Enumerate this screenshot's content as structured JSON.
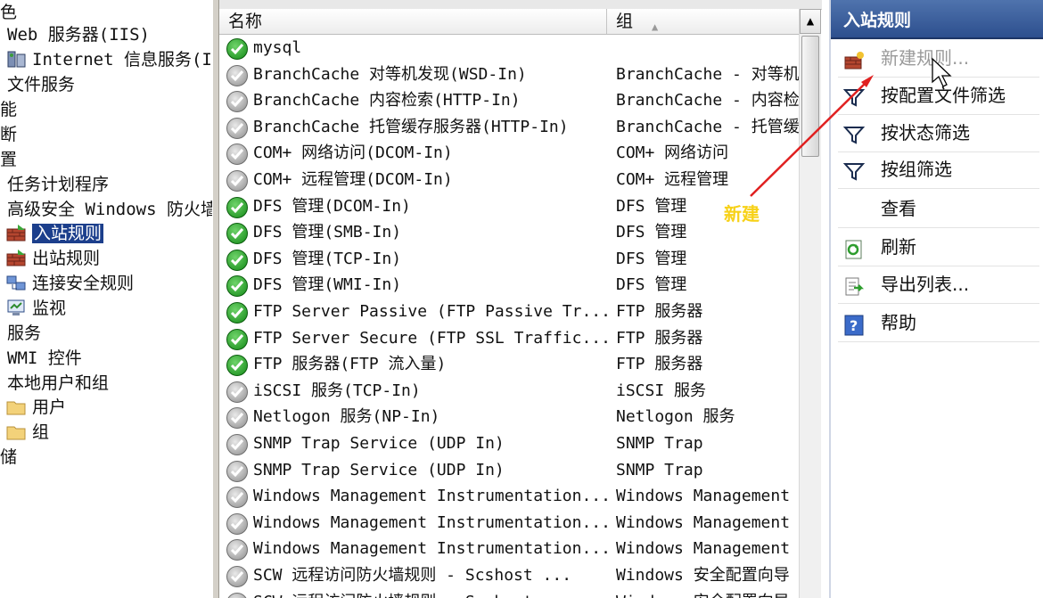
{
  "tree": {
    "items": [
      {
        "label": "色",
        "icon": "none",
        "indent": 0
      },
      {
        "label": "Web 服务器(IIS)",
        "icon": "none",
        "indent": 8
      },
      {
        "label": "Internet 信息服务(I",
        "icon": "iis-icon",
        "indent": 8
      },
      {
        "label": "文件服务",
        "icon": "none",
        "indent": 8
      },
      {
        "label": "能",
        "icon": "none",
        "indent": 0
      },
      {
        "label": "断",
        "icon": "none",
        "indent": 0
      },
      {
        "label": "置",
        "icon": "none",
        "indent": 0
      },
      {
        "label": "任务计划程序",
        "icon": "none",
        "indent": 8
      },
      {
        "label": "高级安全 Windows 防火墙",
        "icon": "none",
        "indent": 8
      },
      {
        "label": "入站规则",
        "icon": "inbound-rules-icon",
        "indent": 8,
        "selected": true
      },
      {
        "label": "出站规则",
        "icon": "outbound-rules-icon",
        "indent": 8
      },
      {
        "label": "连接安全规则",
        "icon": "connection-security-icon",
        "indent": 8
      },
      {
        "label": "监视",
        "icon": "monitor-icon",
        "indent": 8
      },
      {
        "label": "服务",
        "icon": "none",
        "indent": 8
      },
      {
        "label": "WMI 控件",
        "icon": "none",
        "indent": 8
      },
      {
        "label": "本地用户和组",
        "icon": "none",
        "indent": 8
      },
      {
        "label": "用户",
        "icon": "folder-icon",
        "indent": 8
      },
      {
        "label": "组",
        "icon": "folder-icon",
        "indent": 8
      },
      {
        "label": "储",
        "icon": "none",
        "indent": 0
      }
    ]
  },
  "list": {
    "columns": {
      "name": "名称",
      "group": "组"
    },
    "rows": [
      {
        "name": "mysql",
        "group": "",
        "enabled": true
      },
      {
        "name": "BranchCache 对等机发现(WSD-In)",
        "group": "BranchCache - 对等机发现",
        "enabled": false
      },
      {
        "name": "BranchCache 内容检索(HTTP-In)",
        "group": "BranchCache - 内容检索",
        "enabled": false
      },
      {
        "name": "BranchCache 托管缓存服务器(HTTP-In)",
        "group": "BranchCache - 托管缓存",
        "enabled": false
      },
      {
        "name": "COM+ 网络访问(DCOM-In)",
        "group": "COM+ 网络访问",
        "enabled": false
      },
      {
        "name": "COM+ 远程管理(DCOM-In)",
        "group": "COM+ 远程管理",
        "enabled": false
      },
      {
        "name": "DFS 管理(DCOM-In)",
        "group": "DFS 管理",
        "enabled": true
      },
      {
        "name": "DFS 管理(SMB-In)",
        "group": "DFS 管理",
        "enabled": true
      },
      {
        "name": "DFS 管理(TCP-In)",
        "group": "DFS 管理",
        "enabled": true
      },
      {
        "name": "DFS 管理(WMI-In)",
        "group": "DFS 管理",
        "enabled": true
      },
      {
        "name": "FTP Server Passive (FTP Passive Tr...",
        "group": "FTP 服务器",
        "enabled": true
      },
      {
        "name": "FTP Server Secure (FTP SSL Traffic...",
        "group": "FTP 服务器",
        "enabled": true
      },
      {
        "name": "FTP 服务器(FTP 流入量)",
        "group": "FTP 服务器",
        "enabled": true
      },
      {
        "name": "iSCSI 服务(TCP-In)",
        "group": "iSCSI 服务",
        "enabled": false
      },
      {
        "name": "Netlogon 服务(NP-In)",
        "group": "Netlogon 服务",
        "enabled": false
      },
      {
        "name": "SNMP Trap Service (UDP In)",
        "group": "SNMP Trap",
        "enabled": false
      },
      {
        "name": "SNMP Trap Service (UDP In)",
        "group": "SNMP Trap",
        "enabled": false
      },
      {
        "name": "Windows Management Instrumentation...",
        "group": "Windows Management Instrumentation",
        "enabled": false
      },
      {
        "name": "Windows Management Instrumentation...",
        "group": "Windows Management Instrumentation",
        "enabled": false
      },
      {
        "name": "Windows Management Instrumentation...",
        "group": "Windows Management Instrumentation",
        "enabled": false
      },
      {
        "name": "SCW 远程访问防火墙规则 - Scshost ...",
        "group": "Windows 安全配置向导",
        "enabled": false
      },
      {
        "name": "SCW 远程访问防火墙规则 - Scshost ...",
        "group": "Windows 安全配置向导",
        "enabled": false
      }
    ]
  },
  "actions": {
    "title": "入站规则",
    "items": [
      {
        "label": "新建规则...",
        "icon": "new-rule-icon",
        "disabled": true
      },
      {
        "label": "按配置文件筛选",
        "icon": "filter-icon"
      },
      {
        "label": "按状态筛选",
        "icon": "filter-icon"
      },
      {
        "label": "按组筛选",
        "icon": "filter-icon"
      },
      {
        "label": "查看",
        "icon": "none"
      },
      {
        "label": "刷新",
        "icon": "refresh-icon"
      },
      {
        "label": "导出列表...",
        "icon": "export-list-icon"
      },
      {
        "label": "帮助",
        "icon": "help-icon"
      }
    ]
  },
  "annotation": {
    "text": "新建",
    "color": "#f7d117",
    "arrow_color": "#e02020"
  },
  "colors": {
    "selection": "#1c3f8c",
    "actions_header": "#3a5e9c",
    "enabled_rule": "#1e9b22",
    "disabled_rule": "#9a9a9a"
  }
}
